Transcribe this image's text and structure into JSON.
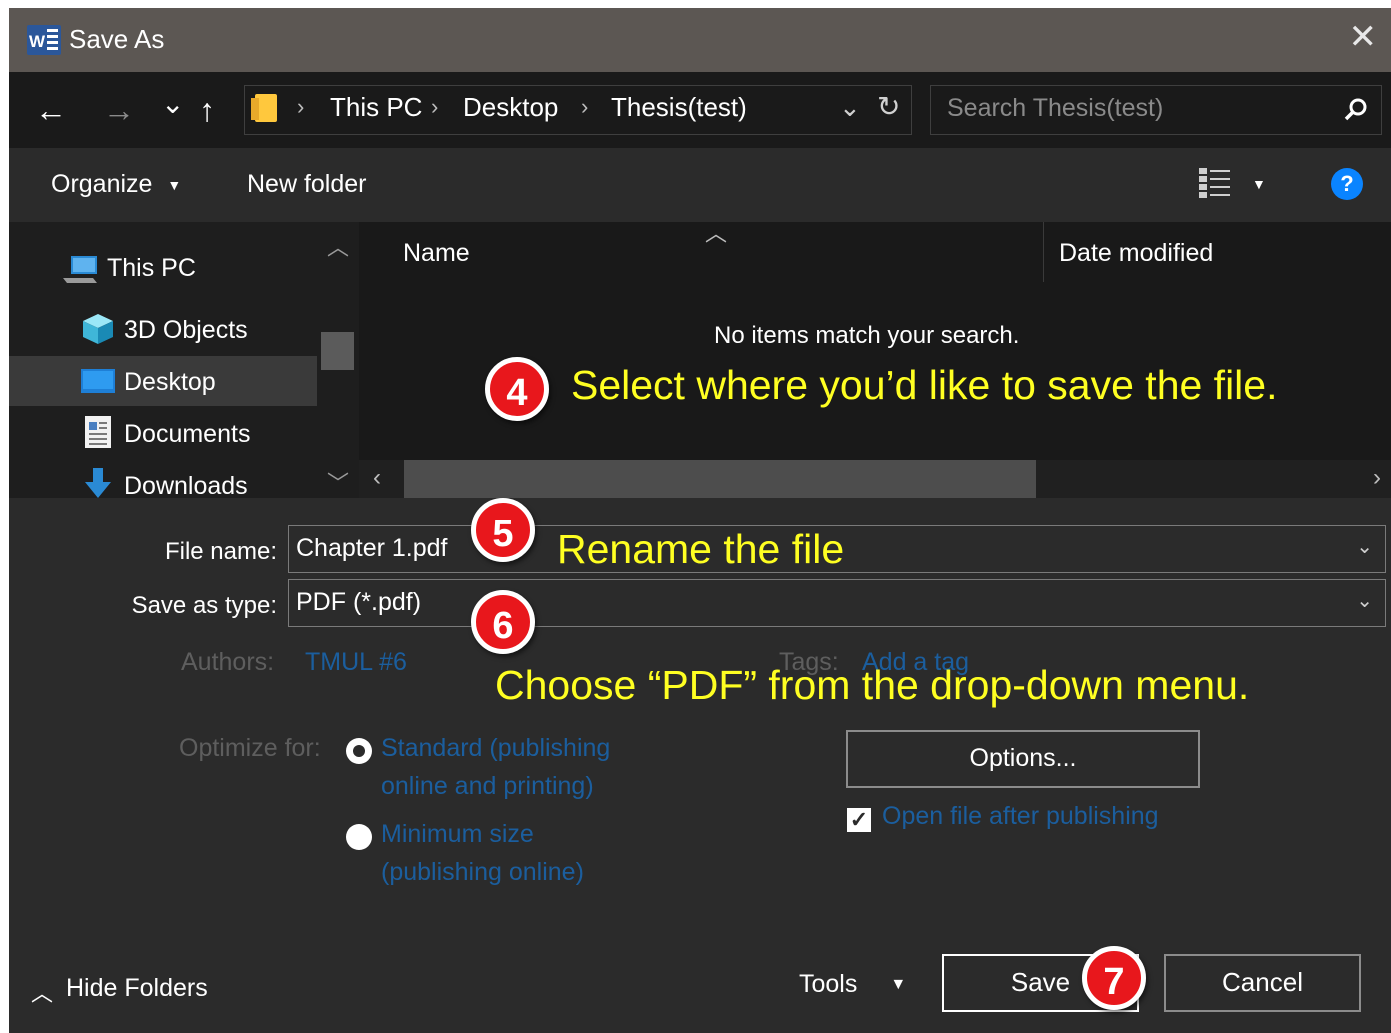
{
  "window": {
    "title": "Save As",
    "app_icon": "word-icon"
  },
  "nav": {
    "back": "←",
    "forward": "→",
    "recent": "⌄",
    "up": "↑",
    "breadcrumbs": [
      "This PC",
      "Desktop",
      "Thesis(test)"
    ],
    "search_placeholder": "Search Thesis(test)"
  },
  "toolbar": {
    "organize": "Organize",
    "new_folder": "New folder",
    "help": "?"
  },
  "sidebar": {
    "items": [
      {
        "label": "This PC",
        "icon": "computer-icon"
      },
      {
        "label": "3D Objects",
        "icon": "cube-icon"
      },
      {
        "label": "Desktop",
        "icon": "desktop-icon",
        "selected": true
      },
      {
        "label": "Documents",
        "icon": "document-icon"
      },
      {
        "label": "Downloads",
        "icon": "download-arrow-icon"
      }
    ]
  },
  "file_list": {
    "columns": [
      "Name",
      "Date modified"
    ],
    "empty_message": "No items match your search."
  },
  "form": {
    "file_name_label": "File name:",
    "file_name_value": "Chapter 1.pdf",
    "save_type_label": "Save as type:",
    "save_type_value": "PDF (*.pdf)",
    "authors_label": "Authors:",
    "authors_value": "TMUL #6",
    "tags_label": "Tags:",
    "tags_value": "Add a tag",
    "optimize_label": "Optimize for:",
    "opt_standard_1": "Standard (publishing",
    "opt_standard_2": "online and printing)",
    "opt_minimum_1": "Minimum size",
    "opt_minimum_2": "(publishing online)",
    "options_button": "Options...",
    "open_after": "Open file after publishing",
    "open_after_checked": true
  },
  "footer": {
    "hide_folders": "Hide Folders",
    "tools": "Tools",
    "save": "Save",
    "cancel": "Cancel"
  },
  "annotations": {
    "step4_number": "4",
    "step4_text": "Select where you’d like to save the file.",
    "step5_number": "5",
    "step5_text": "Rename the file",
    "step6_number": "6",
    "step6_text": "Choose “PDF” from the drop-down menu.",
    "step7_number": "7"
  },
  "colors": {
    "annotation_text": "#ffff22",
    "badge_red": "#e8171c",
    "help_blue": "#0a84ff",
    "link_dim": "#1b5e9e"
  }
}
